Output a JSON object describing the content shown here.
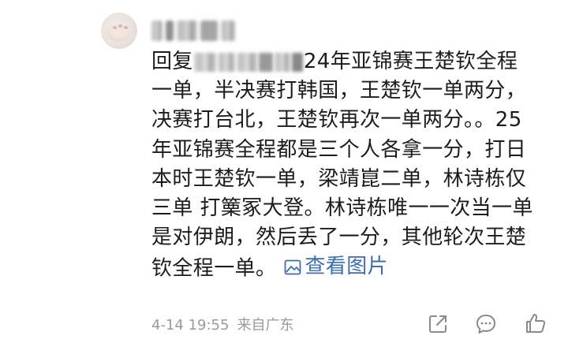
{
  "comment": {
    "reply_prefix": "回复",
    "lines": [
      "24年亚锦赛王楚钦全程",
      "一单，半决赛打韩国，王楚钦一单两分，",
      "决赛打台北，王楚钦再次一单两分。。25",
      "年亚锦赛全程都是三个人各拿一分，打日",
      "本时王楚钦一单，梁靖崑二单，林诗栋仅",
      "三单 打篥冢大登。林诗栋唯一一次当一单",
      "是对伊朗，然后丢了一分，其他轮次王楚",
      "钦全程一单。"
    ],
    "view_image_label": "查看图片",
    "date": "4-14 19:55",
    "location": "来自广东"
  },
  "icons": {
    "view_image": "image-icon",
    "share": "share-icon",
    "comment": "comment-icon",
    "like": "like-icon"
  },
  "colors": {
    "text": "#1c1c1c",
    "link": "#3d6eb0",
    "meta": "#9a9a9a",
    "icon": "#8a8a8a"
  }
}
